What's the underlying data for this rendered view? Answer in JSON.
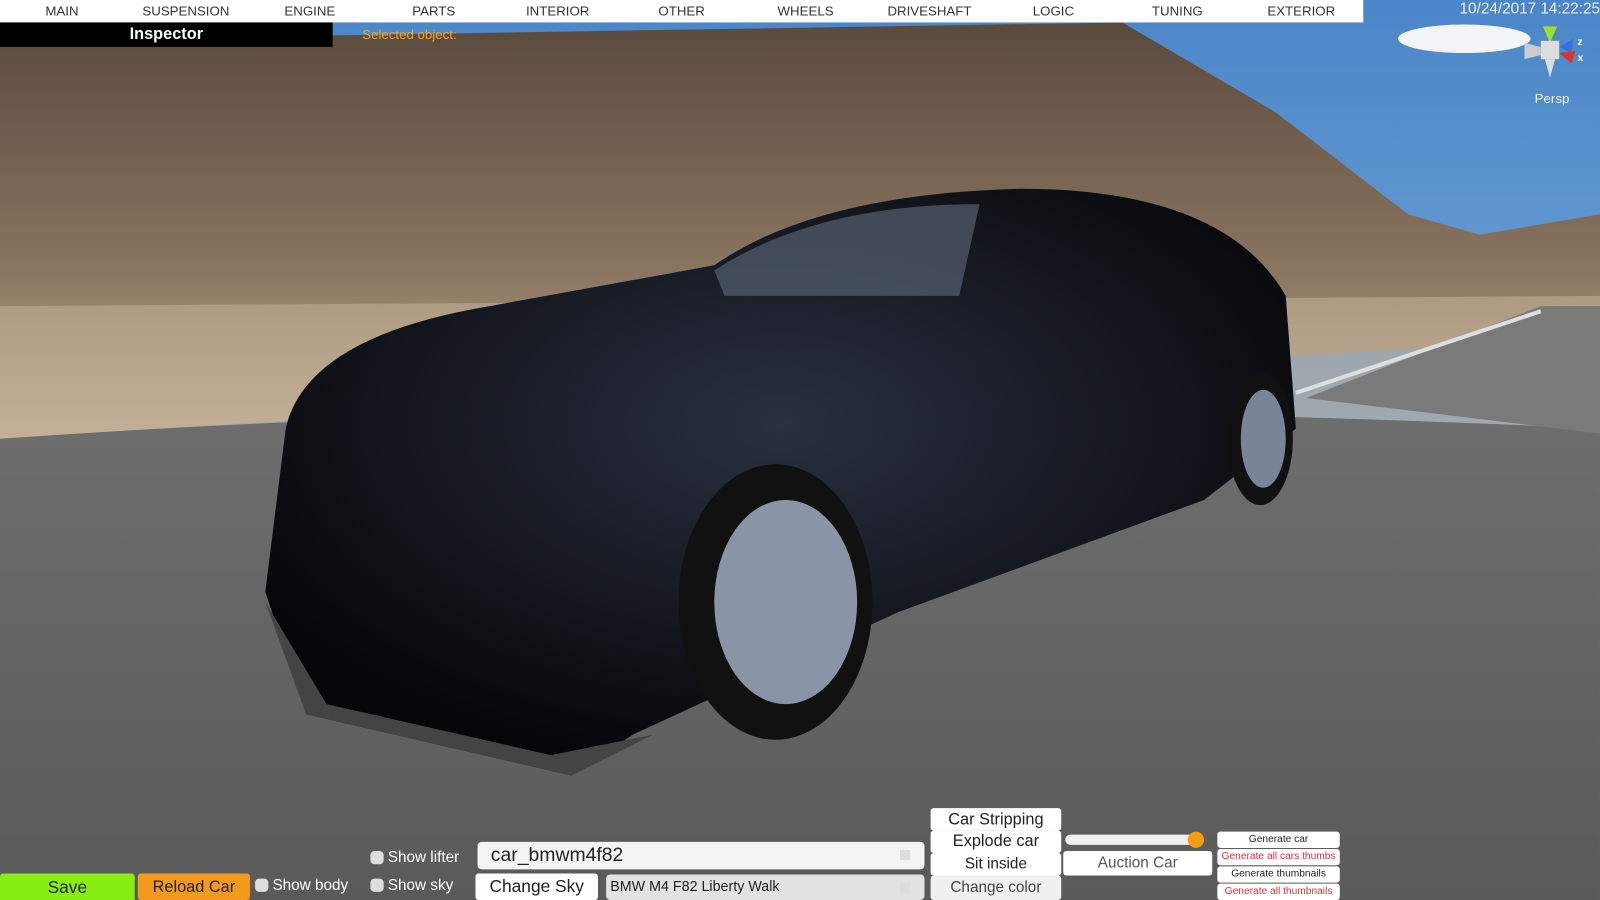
{
  "menu": {
    "tabs": [
      "MAIN",
      "SUSPENSION",
      "ENGINE",
      "PARTS",
      "INTERIOR",
      "OTHER",
      "WHEELS",
      "DRIVESHAFT",
      "LOGIC",
      "TUNING",
      "EXTERIOR"
    ]
  },
  "inspector": {
    "title": "Inspector",
    "selected_label": "Selected object:"
  },
  "viewport": {
    "datetime": "10/24/2017 14:22:25",
    "projection": "Persp",
    "gizmo_axes": [
      "y",
      "z",
      "x"
    ]
  },
  "bottom": {
    "save": "Save",
    "reload": "Reload Car",
    "show_body": "Show body",
    "show_lifter": "Show lifter",
    "show_sky": "Show sky",
    "car_id": "car_bmwm4f82",
    "change_sky": "Change Sky",
    "car_name": "BMW M4 F82 Liberty Walk",
    "car_stripping": "Car Stripping",
    "explode_car": "Explode car",
    "sit_inside": "Sit inside",
    "change_color": "Change color",
    "slider_value": 1.0,
    "auction_car": "Auction Car",
    "generate_car": "Generate car",
    "generate_all_cars_thumbs": "Generate all cars thumbs",
    "generate_thumbnails": "Generate thumbnails",
    "generate_all_thumbnails": "Generate all thumbnails"
  },
  "colors": {
    "save": "#88ee11",
    "reload": "#f39a1e",
    "selected": "#f5a623",
    "danger": "#d9333a"
  }
}
